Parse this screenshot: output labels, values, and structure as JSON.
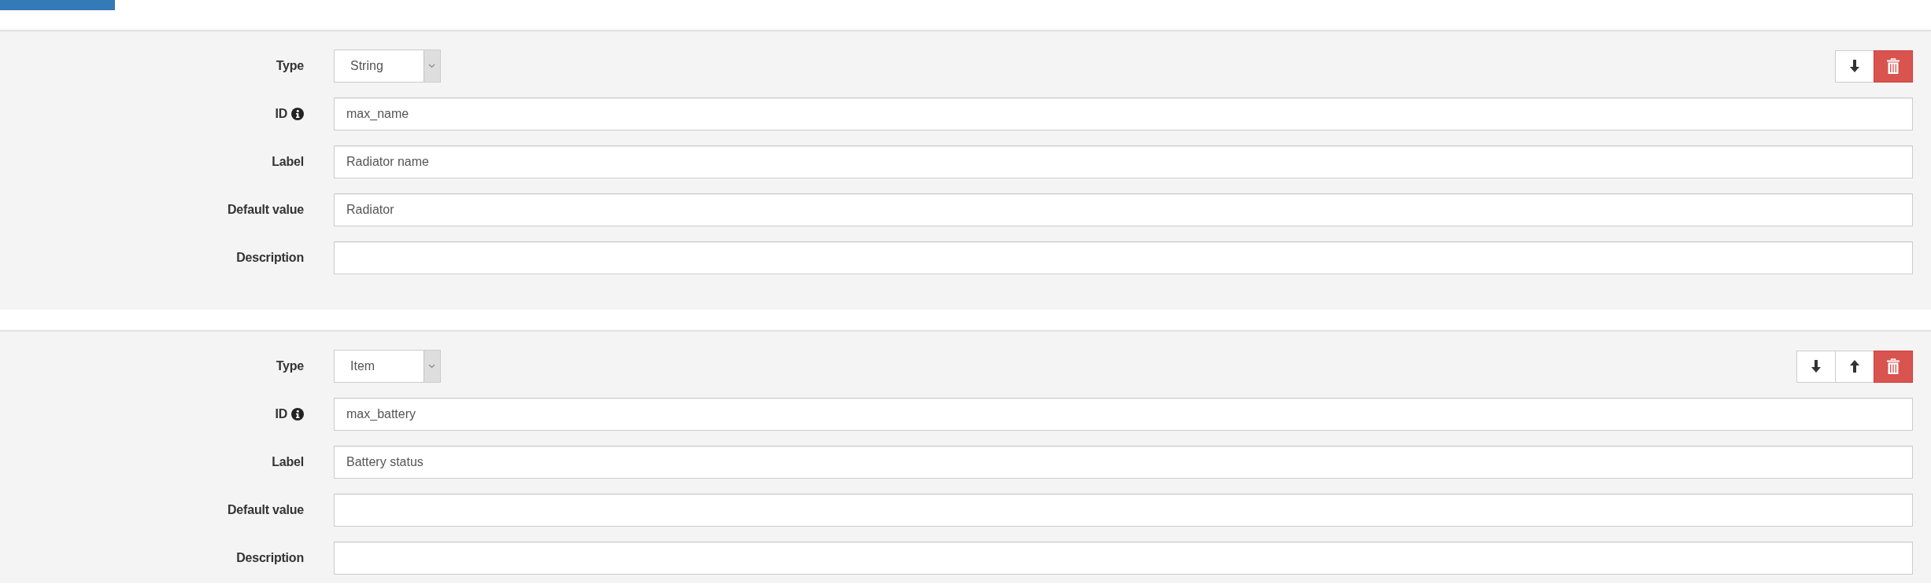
{
  "parameters": [
    {
      "fields": [
        {
          "kind": "select",
          "label": "Type",
          "value": "String",
          "info_icon": false
        },
        {
          "kind": "text",
          "label": "ID",
          "value": "max_name",
          "info_icon": true
        },
        {
          "kind": "text",
          "label": "Label",
          "value": "Radiator name",
          "info_icon": false
        },
        {
          "kind": "text",
          "label": "Default value",
          "value": "Radiator",
          "info_icon": false
        },
        {
          "kind": "text",
          "label": "Description",
          "info_icon": false
        }
      ],
      "actions": [
        {
          "kind": "move_down"
        },
        {
          "kind": "delete"
        }
      ]
    },
    {
      "fields": [
        {
          "kind": "select",
          "label": "Type",
          "value": "Item",
          "info_icon": false
        },
        {
          "kind": "text",
          "label": "ID",
          "value": "max_battery",
          "info_icon": true
        },
        {
          "kind": "text",
          "label": "Label",
          "value": "Battery status",
          "info_icon": false
        },
        {
          "kind": "text",
          "label": "Default value",
          "info_icon": false
        },
        {
          "kind": "text",
          "label": "Description",
          "info_icon": false
        }
      ],
      "actions": [
        {
          "kind": "move_down"
        },
        {
          "kind": "move_up"
        },
        {
          "kind": "delete"
        }
      ]
    }
  ]
}
